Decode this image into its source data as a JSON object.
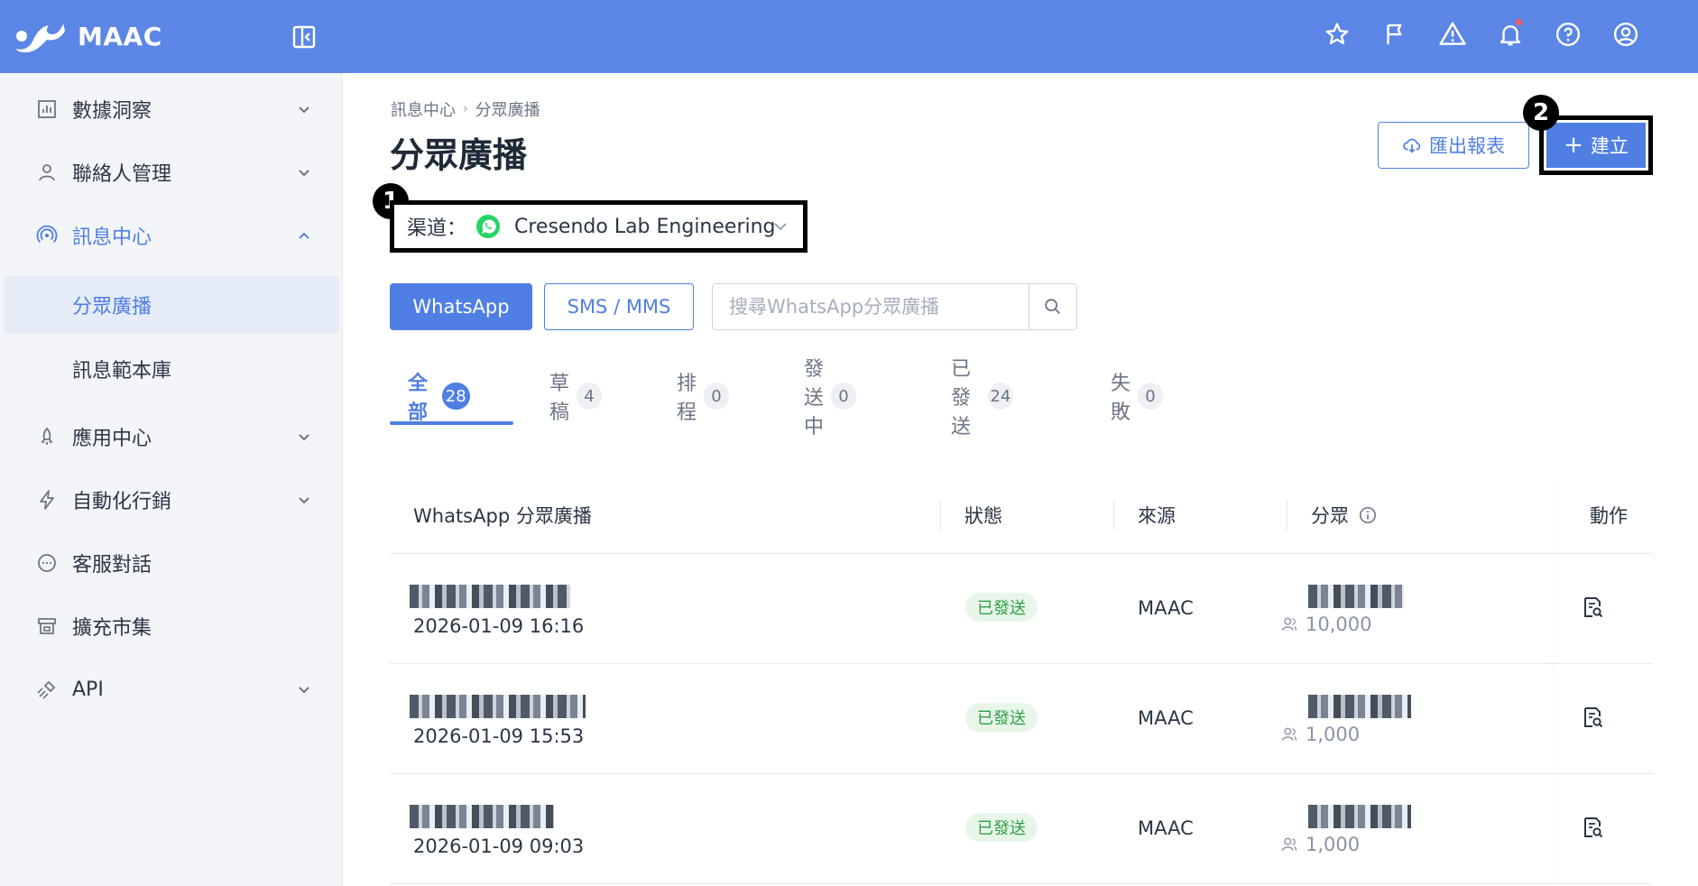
{
  "app": {
    "brand": "MAAC"
  },
  "sidebar": {
    "items": [
      {
        "label": "數據洞察",
        "icon": "chart-icon",
        "expandable": true,
        "expanded": false
      },
      {
        "label": "聯絡人管理",
        "icon": "user-icon",
        "expandable": true,
        "expanded": false
      },
      {
        "label": "訊息中心",
        "icon": "broadcast-icon",
        "expandable": true,
        "expanded": true
      },
      {
        "label": "應用中心",
        "icon": "rocket-icon",
        "expandable": true,
        "expanded": false
      },
      {
        "label": "自動化行銷",
        "icon": "lightning-icon",
        "expandable": true,
        "expanded": false
      },
      {
        "label": "客服對話",
        "icon": "chat-icon",
        "expandable": false
      },
      {
        "label": "擴充市集",
        "icon": "store-icon",
        "expandable": false
      },
      {
        "label": "API",
        "icon": "plug-icon",
        "expandable": true,
        "expanded": false
      }
    ],
    "sub_items": [
      {
        "label": "分眾廣播",
        "selected": true
      },
      {
        "label": "訊息範本庫",
        "selected": false
      }
    ]
  },
  "breadcrumb": [
    "訊息中心",
    "分眾廣播"
  ],
  "page_title": "分眾廣播",
  "actions": {
    "export_label": "匯出報表",
    "create_label": "建立"
  },
  "markers": [
    "1",
    "2"
  ],
  "channel": {
    "label": "渠道：",
    "value": "Cresendo Lab Engineering"
  },
  "type_buttons": {
    "whatsapp": "WhatsApp",
    "sms": "SMS / MMS"
  },
  "search": {
    "placeholder": "搜尋WhatsApp分眾廣播"
  },
  "tabs": [
    {
      "label": "全部",
      "count": "28",
      "active": true
    },
    {
      "label": "草稿",
      "count": "4",
      "active": false
    },
    {
      "label": "排程",
      "count": "0",
      "active": false
    },
    {
      "label": "發送中",
      "count": "0",
      "active": false
    },
    {
      "label": "已發送",
      "count": "24",
      "active": false
    },
    {
      "label": "失敗",
      "count": "0",
      "active": false
    }
  ],
  "table": {
    "headers": {
      "name": "WhatsApp 分眾廣播",
      "status": "狀態",
      "source": "來源",
      "audience": "分眾",
      "action": "動作"
    },
    "rows": [
      {
        "date": "2026-01-09 16:16",
        "status": "已發送",
        "source": "MAAC",
        "audience_count": "10,000"
      },
      {
        "date": "2026-01-09 15:53",
        "status": "已發送",
        "source": "MAAC",
        "audience_count": "1,000"
      },
      {
        "date": "2026-01-09 09:03",
        "status": "已發送",
        "source": "MAAC",
        "audience_count": "1,000"
      }
    ]
  },
  "colors": {
    "topbar": "#5b86e5",
    "accent": "#4f7fe3",
    "status_sent_bg": "#e8f6ea",
    "status_sent_text": "#2f9e45",
    "notification_dot": "#ff5a5a",
    "whatsapp": "#25d366"
  }
}
